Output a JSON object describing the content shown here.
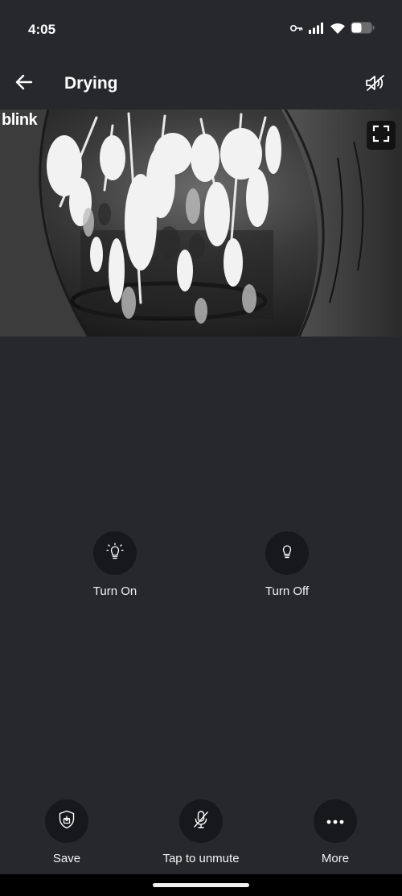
{
  "status_bar": {
    "time": "4:05",
    "icons": [
      "key-icon",
      "signal-icon",
      "wifi-icon",
      "battery-icon"
    ]
  },
  "header": {
    "title": "Drying",
    "back_icon": "arrow-left-icon",
    "speaker_icon": "speaker-muted-icon"
  },
  "video": {
    "logo": "blink",
    "fullscreen_icon": "fullscreen-icon"
  },
  "controls": [
    {
      "label": "Turn On",
      "icon": "bulb-on-icon"
    },
    {
      "label": "Turn Off",
      "icon": "bulb-off-icon"
    }
  ],
  "actions": [
    {
      "label": "Save",
      "icon": "shield-save-icon"
    },
    {
      "label": "Tap to unmute",
      "icon": "mic-muted-icon"
    },
    {
      "label": "More",
      "icon": "more-dots-icon"
    }
  ],
  "colors": {
    "background": "#26282c",
    "button_bg": "#17181b",
    "text": "#ffffff"
  }
}
